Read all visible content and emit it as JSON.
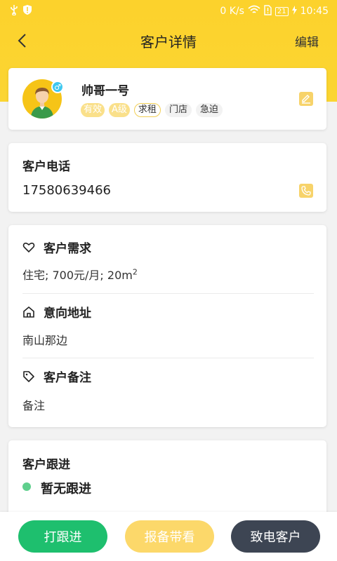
{
  "status_bar": {
    "network": "0 K/s",
    "battery": "21",
    "time": "10:45"
  },
  "app_bar": {
    "title": "客户详情",
    "edit_label": "编辑"
  },
  "profile": {
    "name": "帅哥一号",
    "gender_symbol": "♂",
    "tags": [
      "有效",
      "A级",
      "求租",
      "门店",
      "急迫"
    ]
  },
  "phone": {
    "title": "客户电话",
    "number": "17580639466"
  },
  "needs": {
    "title": "客户需求",
    "value_prefix": "住宅; 700元/月; 20m",
    "value_sup": "2",
    "address_title": "意向地址",
    "address_value": "南山那边",
    "remark_title": "客户备注",
    "remark_value": "备注"
  },
  "follow": {
    "title": "客户跟进",
    "empty_text": "暂无跟进"
  },
  "actions": {
    "follow_label": "打跟进",
    "report_label": "报备带看",
    "call_label": "致电客户"
  },
  "colors": {
    "brand_yellow": "#fcd22c",
    "green": "#1ebf6e",
    "dark": "#3d4553"
  }
}
